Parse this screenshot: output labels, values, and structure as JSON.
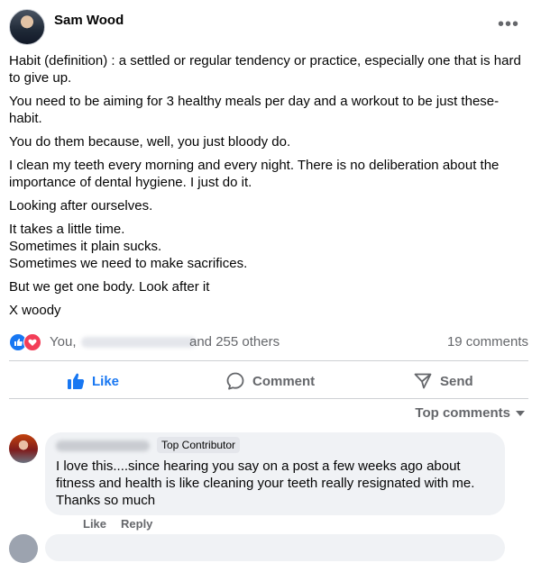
{
  "post": {
    "author": "Sam Wood",
    "more_icon": "more-horizontal-icon",
    "paragraphs": [
      "Habit (definition) : a settled or regular tendency or practice, especially one that is hard to give up.",
      "You need to be aiming for 3 healthy meals per day and a workout to be just these- habit.",
      "You do them because, well, you just bloody do.",
      "I clean my teeth every morning and every night. There is no deliberation about the importance of dental hygiene. I just do it.",
      "Looking after ourselves.",
      "It takes a little time.",
      "Sometimes it plain sucks.",
      "Sometimes we need to make sacrifices.",
      "But we get one body. Look after it",
      "X woody"
    ]
  },
  "reactions": {
    "you": "You,",
    "others": "and 255 others",
    "comments_count": "19 comments",
    "like_color": "#1877f2",
    "love_color": "#f33e58"
  },
  "actions": {
    "like": "Like",
    "comment": "Comment",
    "send": "Send",
    "active_color": "#1877f2"
  },
  "comments": {
    "sort_label": "Top comments",
    "first": {
      "badge": "Top Contributor",
      "text": "I love this....since hearing you say on a post a few weeks ago about fitness and health is like cleaning your teeth really resignated with me. Thanks so much",
      "like": "Like",
      "reply": "Reply"
    }
  }
}
